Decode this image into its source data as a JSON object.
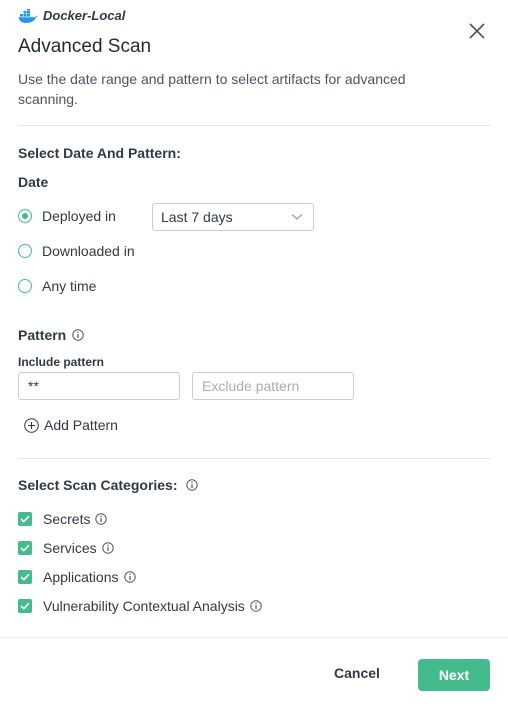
{
  "header": {
    "repo_name": "Docker-Local",
    "title": "Advanced Scan",
    "description": "Use the date range and pattern to select artifacts for advanced scanning."
  },
  "date_pattern": {
    "section_title": "Select Date And Pattern:",
    "date_label": "Date",
    "options": [
      {
        "label": "Deployed in",
        "selected": true
      },
      {
        "label": "Downloaded in",
        "selected": false
      },
      {
        "label": "Any time",
        "selected": false
      }
    ],
    "range_select": {
      "value": "Last 7 days"
    }
  },
  "pattern": {
    "label": "Pattern",
    "include_label": "Include pattern",
    "include_value": "**",
    "exclude_placeholder": "Exclude pattern",
    "add_label": "Add Pattern"
  },
  "categories": {
    "section_title": "Select Scan Categories:",
    "items": [
      {
        "label": "Secrets",
        "checked": true
      },
      {
        "label": "Services",
        "checked": true
      },
      {
        "label": "Applications",
        "checked": true
      },
      {
        "label": "Vulnerability Contextual Analysis",
        "checked": true
      }
    ]
  },
  "footer": {
    "cancel_label": "Cancel",
    "next_label": "Next"
  },
  "colors": {
    "accent": "#43bb8d",
    "docker_blue": "#2496ed"
  },
  "icons": {
    "repo": "docker-whale-icon",
    "close": "close-icon",
    "select_arrow": "chevron-down-icon",
    "info": "info-icon",
    "add": "plus-circle-icon",
    "check": "checkmark-icon"
  }
}
